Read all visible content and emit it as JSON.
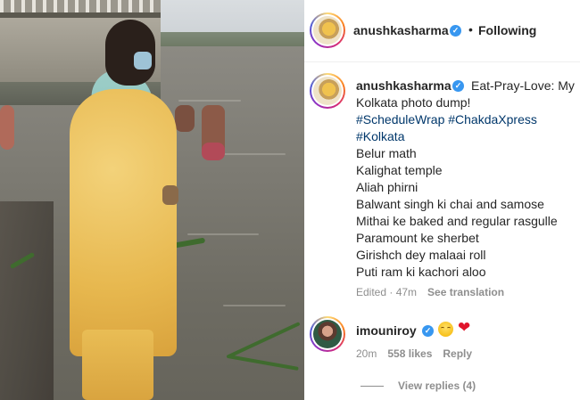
{
  "post": {
    "header": {
      "username": "anushkasharma",
      "verified_icon": "verified-badge-icon",
      "separator": "•",
      "follow_status": "Following"
    },
    "caption": {
      "username": "anushkasharma",
      "first_line": "Eat-Pray-Love: My",
      "lines": [
        "Kolkata photo dump!",
        "#ScheduleWrap #ChakdaXpress",
        "#Kolkata",
        "Belur math",
        "Kalighat temple",
        "Aliah phirni",
        "Balwant singh ki chai and samose",
        "Mithai ke baked and regular rasgulle",
        "Paramount ke sherbet",
        "Girishch dey malaai roll",
        "Puti ram ki kachori aloo"
      ],
      "edited": "Edited · 47m",
      "see_translation": "See translation"
    },
    "comment": {
      "username": "imouniroy",
      "emojis": [
        "smiling-face-icon",
        "red-heart-icon"
      ],
      "time": "20m",
      "likes": "558 likes",
      "reply": "Reply",
      "view_replies": "View replies (4)"
    }
  },
  "colors": {
    "text": "#262626",
    "muted": "#8e8e8e",
    "hashtag": "#00376b",
    "verified": "#3897f0"
  }
}
